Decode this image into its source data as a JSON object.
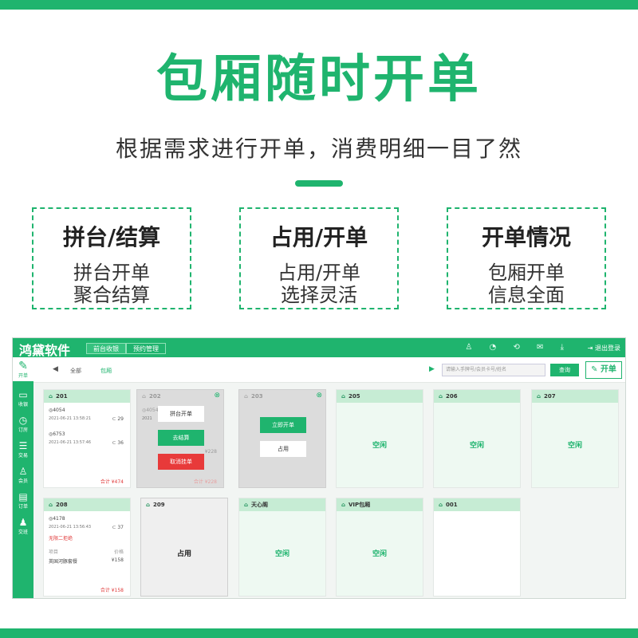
{
  "headline": "包厢随时开单",
  "subline": "根据需求进行开单，消费明细一目了然",
  "features": [
    {
      "title": "拼台/结算",
      "lines": [
        "拼台开单",
        "聚合结算"
      ]
    },
    {
      "title": "占用/开单",
      "lines": [
        "占用/开单",
        "选择灵活"
      ]
    },
    {
      "title": "开单情况",
      "lines": [
        "包厢开单",
        "信息全面"
      ]
    }
  ],
  "colors": {
    "accent": "#1fb46e",
    "danger": "#e83a3a"
  },
  "app": {
    "brand": "鸿黛软件",
    "top_tabs": [
      "前台收银",
      "预约管理"
    ],
    "logout": "退出登录",
    "nav_top": "开单",
    "nav": [
      "收银",
      "订房",
      "交易",
      "会员",
      "订单",
      "交班"
    ],
    "toolbar": {
      "tab1": "全部",
      "tab2": "包厢",
      "search_placeholder": "请输入手牌号/会员卡号/姓名",
      "query": "查询",
      "open": "开单"
    },
    "rooms": {
      "r201": {
        "name": "201",
        "o1": "◎4054",
        "t1": "2021-06-21 13:58:21",
        "c1": "⊂ 29",
        "o2": "◎6753",
        "t2": "2021-06-21 13:57:46",
        "c2": "⊂ 36",
        "total": "合计 ¥474"
      },
      "r202": {
        "name": "202",
        "o1": "◎4054",
        "t1": "2021",
        "amount": "¥228",
        "total": "合计 ¥228",
        "b1": "拼台开单",
        "b2": "去结算",
        "b3": "取消挂单"
      },
      "r203": {
        "name": "203",
        "b1": "立即开单",
        "b2": "占用"
      },
      "r205": {
        "name": "205",
        "status": "空闲"
      },
      "r206": {
        "name": "206",
        "status": "空闲"
      },
      "r207": {
        "name": "207",
        "status": "空闲"
      },
      "r208": {
        "name": "208",
        "o1": "◎4178",
        "t1": "2021-06-21 13:56:43",
        "c1": "⊂ 37",
        "note": "无限二拒绝",
        "label_item": "项目",
        "label_price": "价格",
        "item": "英国河豚套餐",
        "item_price": "¥158",
        "total": "合计 ¥158"
      },
      "r209": {
        "name": "209",
        "status": "占用"
      },
      "rtian": {
        "name": "天心阁",
        "status": "空闲"
      },
      "rvip": {
        "name": "VIP包厢",
        "status": "空闲"
      },
      "r001": {
        "name": "001"
      }
    }
  }
}
